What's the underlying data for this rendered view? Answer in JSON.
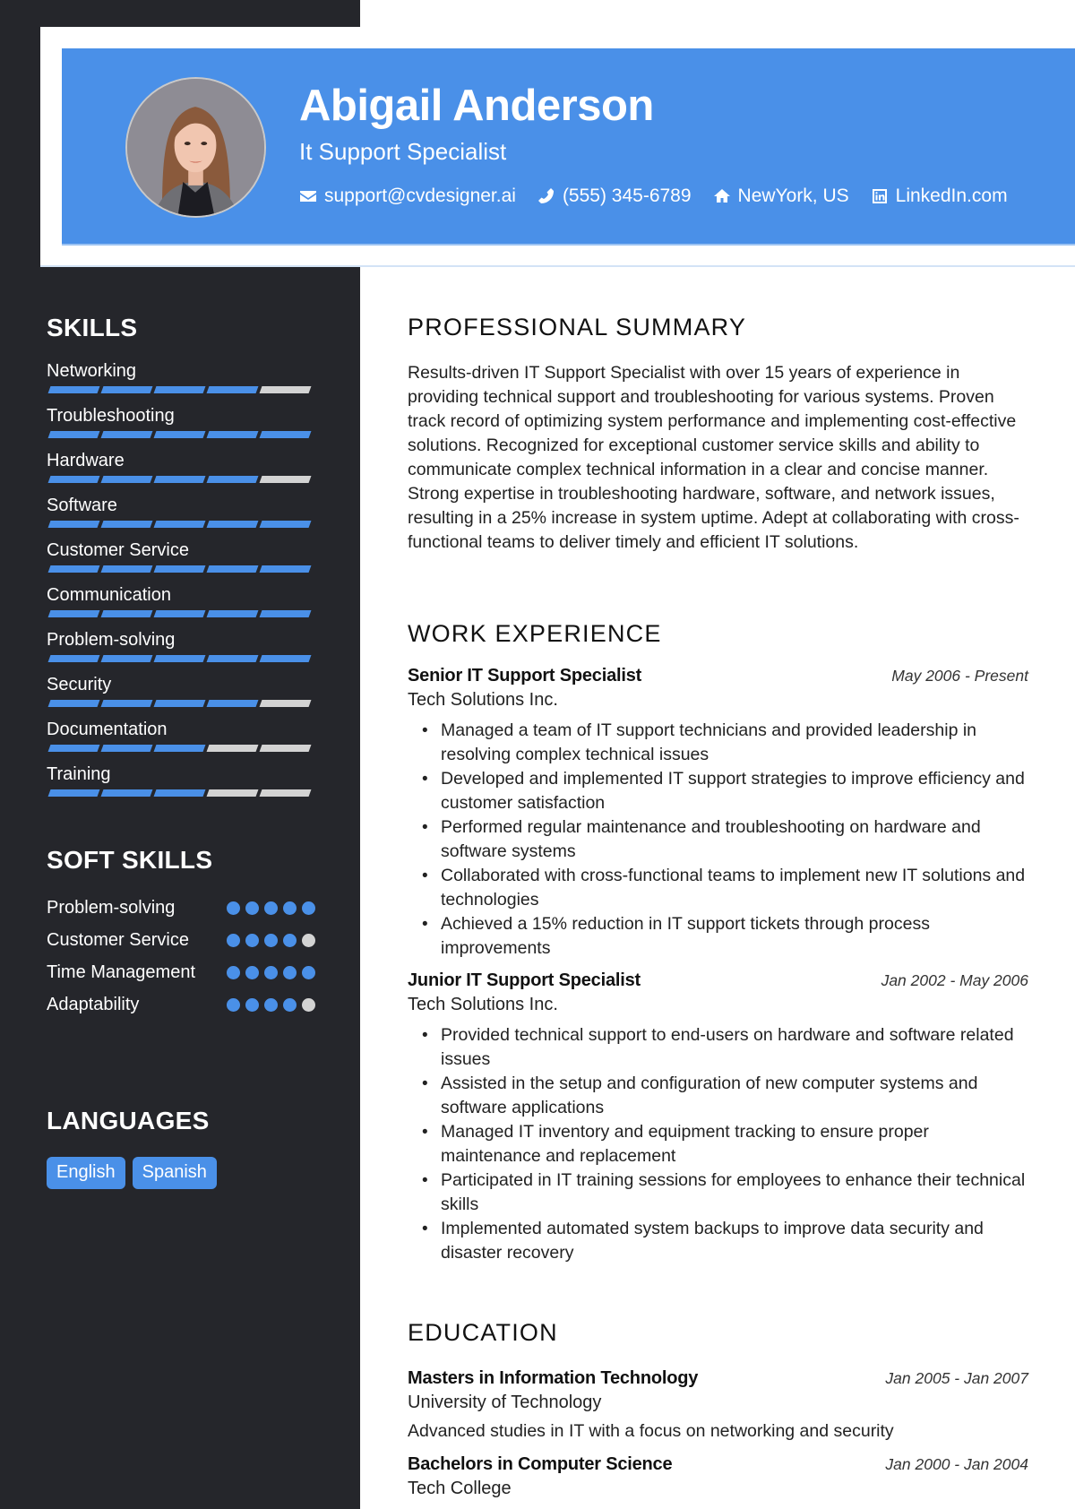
{
  "header": {
    "name": "Abigail Anderson",
    "title": "It Support Specialist",
    "photo_alt": "Profile photo",
    "contacts": [
      {
        "icon": "envelope-icon",
        "text": "support@cvdesigner.ai"
      },
      {
        "icon": "phone-icon",
        "text": "(555) 345-6789"
      },
      {
        "icon": "home-icon",
        "text": "NewYork, US"
      },
      {
        "icon": "linkedin-icon",
        "text": "LinkedIn.com"
      }
    ]
  },
  "colors": {
    "accent": "#4a90e8",
    "sidebar": "#25262b",
    "inactive": "#d3d3d3"
  },
  "sidebar": {
    "skills_heading": "SKILLS",
    "skills": [
      {
        "name": "Networking",
        "level": 4,
        "max": 5
      },
      {
        "name": "Troubleshooting",
        "level": 5,
        "max": 5
      },
      {
        "name": "Hardware",
        "level": 4,
        "max": 5
      },
      {
        "name": "Software",
        "level": 5,
        "max": 5
      },
      {
        "name": "Customer Service",
        "level": 5,
        "max": 5
      },
      {
        "name": "Communication",
        "level": 5,
        "max": 5
      },
      {
        "name": "Problem-solving",
        "level": 5,
        "max": 5
      },
      {
        "name": "Security",
        "level": 4,
        "max": 5
      },
      {
        "name": "Documentation",
        "level": 3,
        "max": 5
      },
      {
        "name": "Training",
        "level": 3,
        "max": 5
      }
    ],
    "soft_skills_heading": "SOFT SKILLS",
    "soft_skills": [
      {
        "name": "Problem-solving",
        "level": 5,
        "max": 5
      },
      {
        "name": "Customer Service",
        "level": 4,
        "max": 5
      },
      {
        "name": "Time Management",
        "level": 5,
        "max": 5
      },
      {
        "name": "Adaptability",
        "level": 4,
        "max": 5
      }
    ],
    "languages_heading": "LANGUAGES",
    "languages": [
      "English",
      "Spanish"
    ]
  },
  "main": {
    "summary_heading": "PROFESSIONAL SUMMARY",
    "summary": "Results-driven IT Support Specialist with over 15 years of experience in providing technical support and troubleshooting for various systems. Proven track record of optimizing system performance and implementing cost-effective solutions. Recognized for exceptional customer service skills and ability to communicate complex technical information in a clear and concise manner. Strong expertise in troubleshooting hardware, software, and network issues, resulting in a 25% increase in system uptime. Adept at collaborating with cross-functional teams to deliver timely and efficient IT solutions.",
    "experience_heading": "WORK EXPERIENCE",
    "jobs": [
      {
        "title": "Senior IT Support Specialist",
        "company": "Tech Solutions Inc.",
        "dates": "May 2006 - Present",
        "bullets": [
          "Managed a team of IT support technicians and provided leadership in resolving complex technical issues",
          "Developed and implemented IT support strategies to improve efficiency and customer satisfaction",
          "Performed regular maintenance and troubleshooting on hardware and software systems",
          "Collaborated with cross-functional teams to implement new IT solutions and technologies",
          "Achieved a 15% reduction in IT support tickets through process improvements"
        ]
      },
      {
        "title": "Junior IT Support Specialist",
        "company": "Tech Solutions Inc.",
        "dates": "Jan 2002 - May 2006",
        "bullets": [
          "Provided technical support to end-users on hardware and software related issues",
          "Assisted in the setup and configuration of new computer systems and software applications",
          "Managed IT inventory and equipment tracking to ensure proper maintenance and replacement",
          "Participated in IT training sessions for employees to enhance their technical skills",
          "Implemented automated system backups to improve data security and disaster recovery"
        ]
      }
    ],
    "education_heading": "EDUCATION",
    "education": [
      {
        "degree": "Masters in Information Technology",
        "school": "University of Technology",
        "dates": "Jan 2005 - Jan 2007",
        "description": "Advanced studies in IT with a focus on networking and security"
      },
      {
        "degree": "Bachelors in Computer Science",
        "school": "Tech College",
        "dates": "Jan 2000 - Jan 2004"
      }
    ]
  }
}
